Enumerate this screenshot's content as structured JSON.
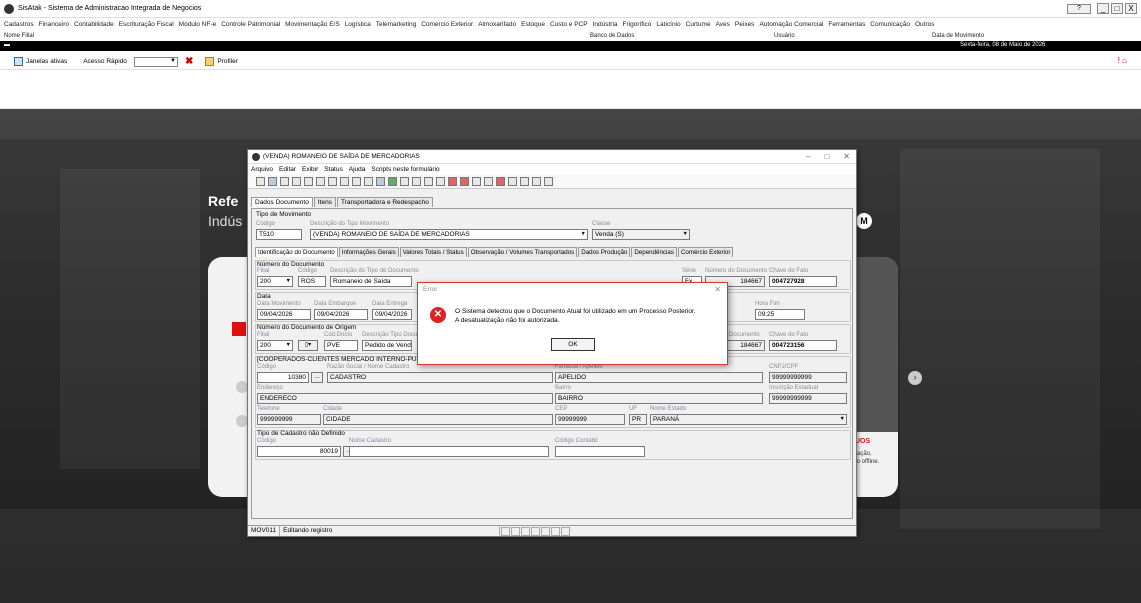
{
  "app": {
    "title": "SisAtak - Sistema de Administracao Integrada de Negocios",
    "help_label": "?",
    "win_min": "_",
    "win_max": "□",
    "win_close": "X"
  },
  "menu": [
    "Cadastros",
    "Financeiro",
    "Contabilidade",
    "Escrituração Fiscal",
    "Módulo NF-e",
    "Controle Patrimonial",
    "Movimentação E/S",
    "Logística",
    "Telemarketing",
    "Comércio Exterior",
    "Almoxarifado",
    "Estoque",
    "Custo e PCP",
    "Indústria",
    "Frigorífico",
    "Laticínio",
    "Curtume",
    "Aves",
    "Peixes",
    "Automação Comercial",
    "Ferramentas",
    "Comunicação",
    "Outros"
  ],
  "info": {
    "nome_filial": "Nome Filial",
    "banco": "Banco de Dados",
    "usuario": "Usuário",
    "data_mov_label": "Data de Movimento",
    "data_mov": "Sexta-feira, 08 de Maio de 2026"
  },
  "toolbar": {
    "janelas": "Janelas ativas",
    "acesso": "Acesso Rápido",
    "profiler": "Profiler"
  },
  "background": {
    "heading": "Refe",
    "subheading": "Indús",
    "m": "M",
    "red_text": "UOS",
    "small1": "ração,",
    "small2": "to offline."
  },
  "window": {
    "title": "(VENDA) ROMANEIO DE SAÍDA DE MERCADORIAS",
    "menu": [
      "Arquivo",
      "Editar",
      "Exibir",
      "Status",
      "Ajuda",
      "Scripts neste formulário"
    ],
    "tabs": [
      "Dados Documento",
      "Itens",
      "Transportadora e Redespacho"
    ],
    "tipo_mov": {
      "section": "Tipo de Movimento",
      "codigo_lbl": "Código",
      "codigo": "T510",
      "desc_lbl": "Descrição do Tipo Movimento",
      "desc": "(VENDA) ROMANEIO DE SAÍDA DE MERCADORIAS",
      "classe_lbl": "Classe",
      "classe": "Venda (S)"
    },
    "subtabs": [
      "Identificação do Documento",
      "Informações Gerais",
      "Valores Totais / Status",
      "Observação / Volumes Transportados",
      "Dados Produção",
      "Dependências",
      "Comércio Exterior"
    ],
    "num_doc": {
      "section": "Número do Documento",
      "filial_lbl": "Filial",
      "filial": "200",
      "codigo_lbl": "Código",
      "codigo": "ROS",
      "desc_lbl": "Descrição do Tipo de Documento",
      "desc": "Romaneio de Saída",
      "serie_lbl": "Série",
      "serie": "Fx",
      "numero_lbl": "Número do Documento",
      "numero": "184667",
      "chave_lbl": "Chave do Fato",
      "chave": "004727928"
    },
    "data": {
      "section": "Data",
      "mov_lbl": "Data Movimento",
      "mov": "09/04/2026",
      "emb_lbl": "Data Embarque",
      "emb": "09/04/2026",
      "ent_lbl": "Data Entrega",
      "ent": "09/04/2026",
      "hora_lbl": "Hora Fim",
      "hora": "09:25"
    },
    "origem": {
      "section": "Número do Documento de Origem",
      "filial_lbl": "Filial",
      "filial": "200",
      "cod_lbl": "Cód.Docto",
      "cod": "PVE",
      "desc_lbl": "Descrição Tipo Documento",
      "desc": "Pedido de Venda",
      "num_lbl": "Documento",
      "num": "184667",
      "chave_lbl": "Chave do Fato",
      "chave": "004723156"
    },
    "cliente": {
      "section": "[COOPERADOS-CLIENTES MERCADO INTERNO-PUNCIONARIOS][DEFAULT]",
      "codigo_lbl": "Código",
      "codigo": "10380",
      "razao_lbl": "Razão Social / Nome Cadastro",
      "razao": "CADASTRO",
      "fantasia_lbl": "Fantasia / Apelido",
      "fantasia": "APELIDO",
      "cnpj_lbl": "CNPJ/CPF",
      "cnpj": "99999999999",
      "end_lbl": "Endereço",
      "end": "ENDERECO",
      "bairro_lbl": "Bairro",
      "bairro": "BAIRRO",
      "ie_lbl": "Inscrição Estadual",
      "ie": "99999999999",
      "tel_lbl": "Telefone",
      "tel": "999999999",
      "cidade_lbl": "Cidade",
      "cidade": "CIDADE",
      "cep_lbl": "CEP",
      "cep": "99999999",
      "uf_lbl": "UF",
      "uf": "PR",
      "estado_lbl": "Nome Estado",
      "estado": "PARANÁ"
    },
    "tipo_cad": {
      "section": "Tipo de Cadastro não Definido",
      "codigo_lbl": "Código",
      "codigo": "80019",
      "nome_lbl": "Nome Cadastro",
      "contabil_lbl": "Código Contábil"
    },
    "status": {
      "code": "MOV011",
      "text": "Editando registro"
    }
  },
  "dialog": {
    "title": "Error",
    "close": "✕",
    "icon": "✕",
    "msg1": "O Sistema detectou que o Documento Atual foi utilizado em um Processo Posterior.",
    "msg2": "A desatualização não foi autorizada.",
    "ok": "OK"
  }
}
